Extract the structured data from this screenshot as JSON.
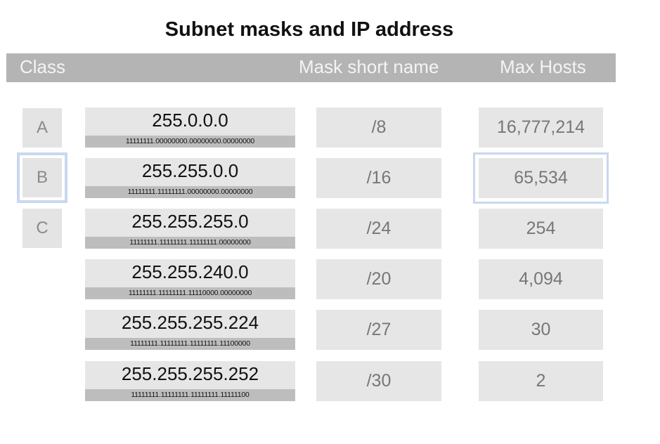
{
  "title": "Subnet masks and IP address",
  "headers": {
    "class": "Class",
    "mask_short_name": "Mask short name",
    "max_hosts": "Max Hosts"
  },
  "classes": [
    "A",
    "B",
    "C"
  ],
  "selected_class": "B",
  "rows": [
    {
      "mask": "255.0.0.0",
      "binary": "11111111.00000000.00000000.00000000",
      "short": "/8",
      "hosts": "16,777,214"
    },
    {
      "mask": "255.255.0.0",
      "binary": "11111111.11111111.00000000.00000000",
      "short": "/16",
      "hosts": "65,534"
    },
    {
      "mask": "255.255.255.0",
      "binary": "11111111.11111111.11111111.00000000",
      "short": "/24",
      "hosts": "254"
    },
    {
      "mask": "255.255.240.0",
      "binary": "11111111.11111111.11110000.00000000",
      "short": "/20",
      "hosts": "4,094"
    },
    {
      "mask": "255.255.255.224",
      "binary": "11111111.11111111.11111111.11100000",
      "short": "/27",
      "hosts": "30"
    },
    {
      "mask": "255.255.255.252",
      "binary": "11111111.11111111.11111111.11111100",
      "short": "/30",
      "hosts": "2"
    }
  ],
  "colors": {
    "header_bg": "#b4b4b4",
    "cell_bg": "#e6e6e6",
    "binary_bg": "#bdbdbd",
    "selection": "#c9d8ef"
  }
}
